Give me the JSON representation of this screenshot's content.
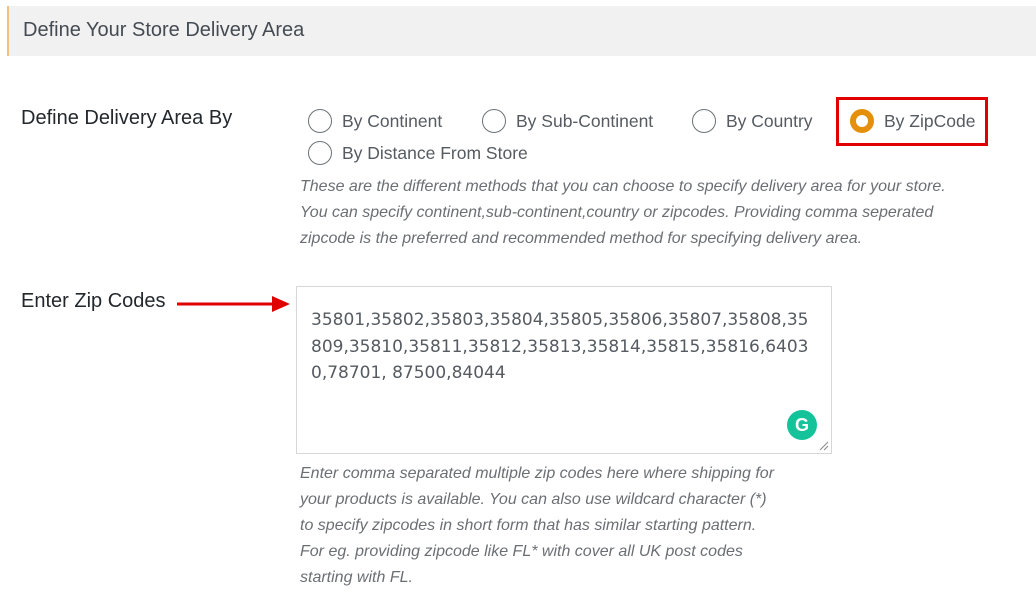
{
  "header": {
    "title": "Define Your Store Delivery Area"
  },
  "delivery_area": {
    "label": "Define Delivery Area By",
    "options": [
      {
        "label": "By Continent",
        "checked": false
      },
      {
        "label": "By Sub-Continent",
        "checked": false
      },
      {
        "label": "By Country",
        "checked": false
      },
      {
        "label": "By ZipCode",
        "checked": true
      },
      {
        "label": "By Distance From Store",
        "checked": false
      }
    ],
    "help_lines": [
      "These are the different methods that you can choose to specify delivery area for your store.",
      "You can specify continent,sub-continent,country or zipcodes. Providing comma seperated",
      "zipcode is the preferred and recommended method for specifying delivery area."
    ]
  },
  "zip_codes": {
    "label": "Enter Zip Codes",
    "value_lines": [
      "35801,35802,35803,35804,35805,35806,35807,35808,35",
      "809,35810,35811,35812,35813,35814,35815,35816,6403",
      "0,78701, 87500,84044"
    ],
    "grammarly_icon": "G",
    "help_lines": [
      "Enter comma separated multiple zip codes here where shipping for",
      "your products is available. You can also use wildcard character (*)",
      "to specify zipcodes in short form that has similar starting pattern.",
      "For eg. providing zipcode like FL* with cover all UK post codes",
      "starting with FL."
    ]
  },
  "colors": {
    "radio_checked": "#e4900a",
    "highlight": "#e00000",
    "arrow": "#e00000",
    "grammarly": "#15c39a"
  }
}
